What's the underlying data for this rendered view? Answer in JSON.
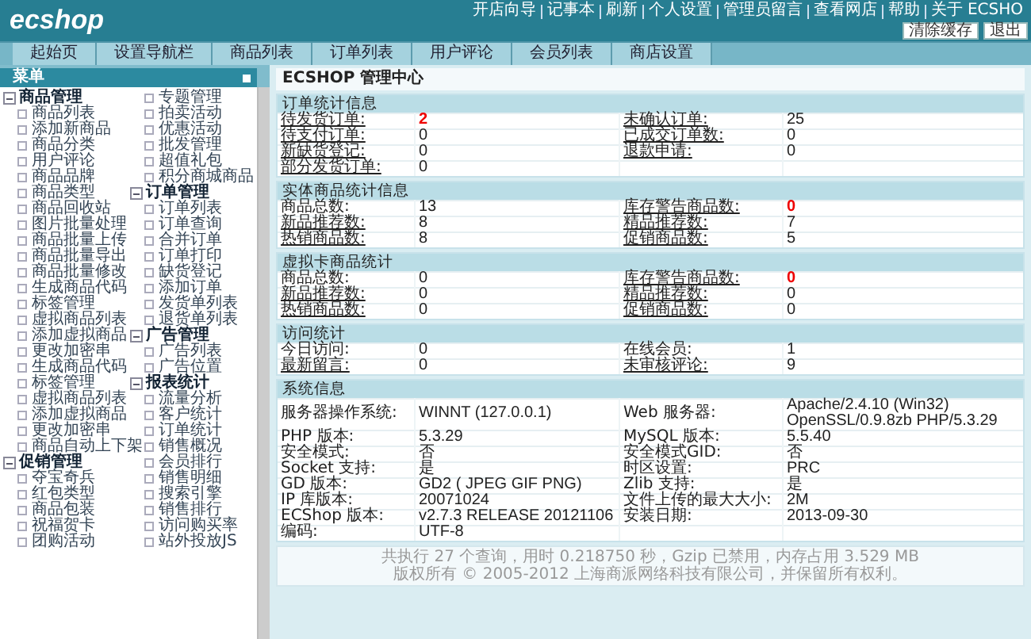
{
  "header": {
    "logo": "ecshop",
    "links": [
      "开店向导",
      "记事本",
      "刷新",
      "个人设置",
      "管理员留言",
      "查看网店",
      "帮助",
      "关于 ECSHO"
    ],
    "buttons": [
      "清除缓存",
      "退出"
    ]
  },
  "tabs": [
    {
      "label": "起始页"
    },
    {
      "label": "设置导航栏"
    },
    {
      "label": "商品列表"
    },
    {
      "label": "订单列表"
    },
    {
      "label": "用户评论"
    },
    {
      "label": "会员列表"
    },
    {
      "label": "商店设置"
    }
  ],
  "sidebar": {
    "title": "菜单",
    "groups": [
      {
        "label": "商品管理",
        "expanded": true,
        "children": [
          {
            "label": "商品列表"
          },
          {
            "label": "添加新商品"
          },
          {
            "label": "商品分类"
          },
          {
            "label": "用户评论"
          },
          {
            "label": "商品品牌"
          },
          {
            "label": "商品类型"
          },
          {
            "label": "商品回收站"
          },
          {
            "label": "图片批量处理"
          },
          {
            "label": "商品批量上传"
          },
          {
            "label": "商品批量导出"
          },
          {
            "label": "商品批量修改"
          },
          {
            "label": "生成商品代码"
          },
          {
            "label": "标签管理"
          },
          {
            "label": "虚拟商品列表"
          },
          {
            "label": "添加虚拟商品"
          },
          {
            "label": "更改加密串"
          },
          {
            "label": "生成商品代码"
          },
          {
            "label": "标签管理"
          },
          {
            "label": "虚拟商品列表"
          },
          {
            "label": "添加虚拟商品"
          },
          {
            "label": "更改加密串"
          },
          {
            "label": "商品自动上下架"
          }
        ]
      },
      {
        "label": "促销管理",
        "expanded": true,
        "children": [
          {
            "label": "夺宝奇兵"
          },
          {
            "label": "红包类型"
          },
          {
            "label": "商品包装"
          },
          {
            "label": "祝福贺卡"
          },
          {
            "label": "团购活动"
          },
          {
            "label": "专题管理"
          },
          {
            "label": "拍卖活动"
          },
          {
            "label": "优惠活动"
          },
          {
            "label": "批发管理"
          },
          {
            "label": "超值礼包"
          },
          {
            "label": "积分商城商品"
          }
        ]
      },
      {
        "label": "订单管理",
        "expanded": true,
        "children": [
          {
            "label": "订单列表"
          },
          {
            "label": "订单查询"
          },
          {
            "label": "合并订单"
          },
          {
            "label": "订单打印"
          },
          {
            "label": "缺货登记"
          },
          {
            "label": "添加订单"
          },
          {
            "label": "发货单列表"
          },
          {
            "label": "退货单列表"
          }
        ]
      },
      {
        "label": "广告管理",
        "expanded": true,
        "children": [
          {
            "label": "广告列表"
          },
          {
            "label": "广告位置"
          }
        ]
      },
      {
        "label": "报表统计",
        "expanded": true,
        "children": [
          {
            "label": "流量分析"
          },
          {
            "label": "客户统计"
          },
          {
            "label": "订单统计"
          },
          {
            "label": "销售概况"
          },
          {
            "label": "会员排行"
          },
          {
            "label": "销售明细"
          },
          {
            "label": "搜索引擎"
          },
          {
            "label": "销售排行"
          },
          {
            "label": "访问购买率"
          },
          {
            "label": "站外投放JS"
          }
        ]
      }
    ]
  },
  "main": {
    "title": "ECSHOP 管理中心",
    "sections": [
      {
        "title": "订单统计信息",
        "rows": [
          [
            {
              "label": "待发货订单:",
              "link": true,
              "value": "2",
              "alert": true
            },
            {
              "label": "未确认订单:",
              "link": true,
              "value": "25",
              "alert": false
            }
          ],
          [
            {
              "label": "待支付订单:",
              "link": true,
              "value": "0",
              "alert": false
            },
            {
              "label": "已成交订单数:",
              "link": true,
              "value": "0",
              "alert": false
            }
          ],
          [
            {
              "label": "新缺货登记:",
              "link": true,
              "value": "0",
              "alert": false
            },
            {
              "label": "退款申请:",
              "link": true,
              "value": "0",
              "alert": false
            }
          ],
          [
            {
              "label": "部分发货订单:",
              "link": true,
              "value": "0",
              "alert": false
            }
          ]
        ]
      },
      {
        "title": "实体商品统计信息",
        "rows": [
          [
            {
              "label": "商品总数:",
              "link": false,
              "value": "13",
              "alert": false
            },
            {
              "label": "库存警告商品数:",
              "link": true,
              "value": "0",
              "alert": true
            }
          ],
          [
            {
              "label": "新品推荐数:",
              "link": true,
              "value": "8",
              "alert": false
            },
            {
              "label": "精品推荐数:",
              "link": true,
              "value": "7",
              "alert": false
            }
          ],
          [
            {
              "label": "热销商品数:",
              "link": true,
              "value": "8",
              "alert": false
            },
            {
              "label": "促销商品数:",
              "link": true,
              "value": "5",
              "alert": false
            }
          ]
        ]
      },
      {
        "title": "虚拟卡商品统计",
        "rows": [
          [
            {
              "label": "商品总数:",
              "link": false,
              "value": "0",
              "alert": false
            },
            {
              "label": "库存警告商品数:",
              "link": true,
              "value": "0",
              "alert": true
            }
          ],
          [
            {
              "label": "新品推荐数:",
              "link": true,
              "value": "0",
              "alert": false
            },
            {
              "label": "精品推荐数:",
              "link": true,
              "value": "0",
              "alert": false
            }
          ],
          [
            {
              "label": "热销商品数:",
              "link": true,
              "value": "0",
              "alert": false
            },
            {
              "label": "促销商品数:",
              "link": true,
              "value": "0",
              "alert": false
            }
          ]
        ]
      },
      {
        "title": "访问统计",
        "rows": [
          [
            {
              "label": "今日访问:",
              "link": false,
              "value": "0",
              "alert": false
            },
            {
              "label": "在线会员:",
              "link": false,
              "value": "1",
              "alert": false
            }
          ],
          [
            {
              "label": "最新留言:",
              "link": true,
              "value": "0",
              "alert": false
            },
            {
              "label": "未审核评论:",
              "link": true,
              "value": "9",
              "alert": false
            }
          ]
        ]
      },
      {
        "title": "系统信息",
        "rows": [
          [
            {
              "label": "服务器操作系统:",
              "link": false,
              "value": "WINNT (127.0.0.1)",
              "alert": false
            },
            {
              "label": "Web 服务器:",
              "link": false,
              "value": "Apache/2.4.10 (Win32) OpenSSL/0.9.8zb PHP/5.3.29",
              "alert": false
            }
          ],
          [
            {
              "label": "PHP 版本:",
              "link": false,
              "value": "5.3.29",
              "alert": false
            },
            {
              "label": "MySQL 版本:",
              "link": false,
              "value": "5.5.40",
              "alert": false
            }
          ],
          [
            {
              "label": "安全模式:",
              "link": false,
              "value": "否",
              "alert": false
            },
            {
              "label": "安全模式GID:",
              "link": false,
              "value": "否",
              "alert": false
            }
          ],
          [
            {
              "label": "Socket 支持:",
              "link": false,
              "value": "是",
              "alert": false
            },
            {
              "label": "时区设置:",
              "link": false,
              "value": "PRC",
              "alert": false
            }
          ],
          [
            {
              "label": "GD 版本:",
              "link": false,
              "value": "GD2 ( JPEG GIF PNG)",
              "alert": false
            },
            {
              "label": "Zlib 支持:",
              "link": false,
              "value": "是",
              "alert": false
            }
          ],
          [
            {
              "label": "IP 库版本:",
              "link": false,
              "value": "20071024",
              "alert": false
            },
            {
              "label": "文件上传的最大大小:",
              "link": false,
              "value": "2M",
              "alert": false
            }
          ],
          [
            {
              "label": "ECShop 版本:",
              "link": false,
              "value": "v2.7.3 RELEASE 20121106",
              "alert": false
            },
            {
              "label": "安装日期:",
              "link": false,
              "value": "2013-09-30",
              "alert": false
            }
          ],
          [
            {
              "label": "编码:",
              "link": false,
              "value": "UTF-8",
              "alert": false
            }
          ]
        ]
      }
    ],
    "footer": [
      "共执行 27 个查询，用时 0.218750 秒，Gzip 已禁用，内存占用 3.529 MB",
      "版权所有 © 2005-2012 上海商派网络科技有限公司，并保留所有权利。"
    ]
  }
}
